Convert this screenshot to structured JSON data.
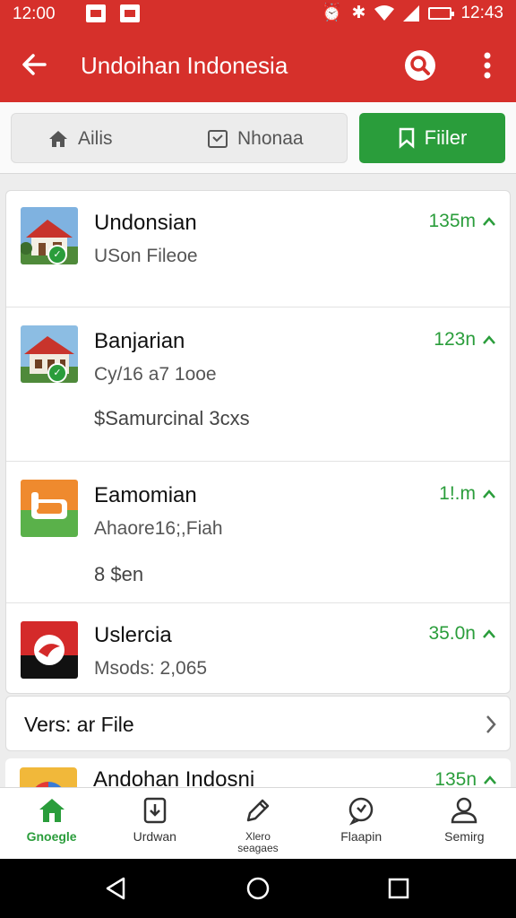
{
  "status_bar": {
    "left_time": "12:00",
    "right_time": "12:43"
  },
  "app_bar": {
    "title": "Undoihan Indonesia",
    "icons": [
      "arrow-back-icon",
      "search-icon",
      "more-vert-icon"
    ]
  },
  "filter_strip": {
    "segments": [
      {
        "label": "Ailis",
        "icon": "home-icon"
      },
      {
        "label": "Nhonaa",
        "icon": "checkbox-icon"
      }
    ],
    "filter_button": {
      "label": "Fiiler",
      "icon": "bookmark-icon"
    }
  },
  "list": [
    {
      "title": "Undonsian",
      "subtitle": "USon Fileoe",
      "extra": "",
      "size": "135m"
    },
    {
      "title": "Banjarian",
      "subtitle": "Cy/16 a7 1ooe",
      "extra": "$Samurcinal 3cxs",
      "size": "123n"
    },
    {
      "title": "Eamomian",
      "subtitle": "Ahaore16;,Fiah",
      "extra": "8 $en",
      "size": "1!.m"
    },
    {
      "title": "Uslercia",
      "subtitle": "Msods: 2,065",
      "extra": "",
      "size": "35.0n"
    }
  ],
  "version_row": {
    "label": "Vers: ar File"
  },
  "peek_row": {
    "title": "Andohan Indosni",
    "size": "135n"
  },
  "bottom_nav": [
    {
      "label": "Gnoegle",
      "icon": "home-icon",
      "active": true
    },
    {
      "label": "Urdwan",
      "icon": "download-icon",
      "active": false
    },
    {
      "label": "Xlero\nseagaes",
      "icon": "edit-icon",
      "active": false
    },
    {
      "label": "Flaapin",
      "icon": "chat-icon",
      "active": false
    },
    {
      "label": "Semirg",
      "icon": "person-icon",
      "active": false
    }
  ],
  "colors": {
    "app_bar": "#d6302b",
    "accent_green": "#2a9d3b"
  }
}
